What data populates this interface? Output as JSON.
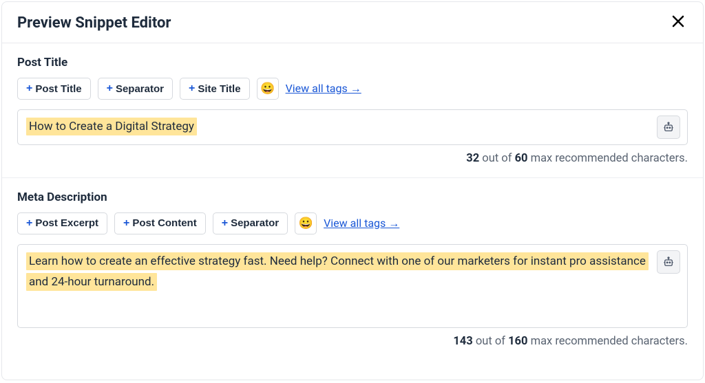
{
  "header": {
    "title": "Preview Snippet Editor"
  },
  "postTitle": {
    "label": "Post Title",
    "tags": [
      "Post Title",
      "Separator",
      "Site Title"
    ],
    "viewAll": "View all tags →",
    "value": "How to Create a Digital Strategy",
    "count": "32",
    "countMid": " out of ",
    "max": "60",
    "countTail": " max recommended characters."
  },
  "metaDesc": {
    "label": "Meta Description",
    "tags": [
      "Post Excerpt",
      "Post Content",
      "Separator"
    ],
    "viewAll": "View all tags →",
    "value": "Learn how to create an effective strategy fast. Need help? Connect with one of our marketers for instant pro assistance and 24-hour turnaround.",
    "count": "143",
    "countMid": " out of ",
    "max": "160",
    "countTail": " max recommended characters."
  },
  "emoji": "😀"
}
